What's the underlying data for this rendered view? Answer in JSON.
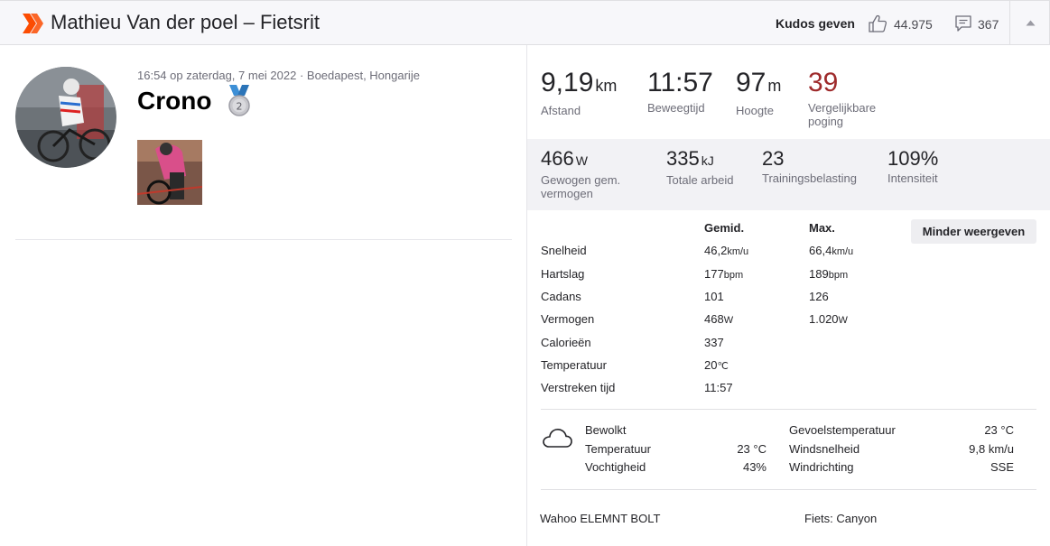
{
  "header": {
    "title": "Mathieu Van der poel – Fietsrit",
    "kudos_label": "Kudos geven",
    "kudos_count": "44.975",
    "comments_count": "367",
    "brand_color": "#fc4c02"
  },
  "activity": {
    "datetime_location": "16:54 op zaterdag, 7 mei 2022 · Boedapest, Hongarije",
    "name": "Crono",
    "medal_rank": "2"
  },
  "primary_stats": [
    {
      "value": "9,19",
      "unit": "km",
      "label": "Afstand"
    },
    {
      "value": "11:57",
      "unit": "",
      "label": "Beweegtijd"
    },
    {
      "value": "97",
      "unit": "m",
      "label": "Hoogte"
    },
    {
      "value": "39",
      "unit": "",
      "label": "Vergelijkbare poging"
    }
  ],
  "secondary_stats": [
    {
      "value": "466",
      "unit": "W",
      "label": "Gewogen gem. vermogen"
    },
    {
      "value": "335",
      "unit": "kJ",
      "label": "Totale arbeid"
    },
    {
      "value": "23",
      "unit": "",
      "label": "Trainingsbelasting"
    },
    {
      "value": "109%",
      "unit": "",
      "label": "Intensiteit"
    }
  ],
  "details": {
    "header_avg": "Gemid.",
    "header_max": "Max.",
    "less_button": "Minder weergeven",
    "rows": [
      {
        "label": "Snelheid",
        "avg": "46,2",
        "avg_unit": "km/u",
        "max": "66,4",
        "max_unit": "km/u"
      },
      {
        "label": "Hartslag",
        "avg": "177",
        "avg_unit": "bpm",
        "max": "189",
        "max_unit": "bpm"
      },
      {
        "label": "Cadans",
        "avg": "101",
        "avg_unit": "",
        "max": "126",
        "max_unit": ""
      },
      {
        "label": "Vermogen",
        "avg": "468",
        "avg_unit": "W",
        "max": "1.020",
        "max_unit": "W"
      },
      {
        "label": "Calorieën",
        "avg": "337",
        "avg_unit": "",
        "max": "",
        "max_unit": ""
      },
      {
        "label": "Temperatuur",
        "avg": "20",
        "avg_unit": "℃",
        "max": "",
        "max_unit": ""
      },
      {
        "label": "Verstreken tijd",
        "avg": "11:57",
        "avg_unit": "",
        "max": "",
        "max_unit": ""
      }
    ]
  },
  "weather": {
    "condition": "Bewolkt",
    "left": [
      {
        "label": "Temperatuur",
        "value": "23 °C"
      },
      {
        "label": "Vochtigheid",
        "value": "43%"
      }
    ],
    "right": [
      {
        "label": "Gevoelstemperatuur",
        "value": "23 °C"
      },
      {
        "label": "Windsnelheid",
        "value": "9,8 km/u"
      },
      {
        "label": "Windrichting",
        "value": "SSE"
      }
    ]
  },
  "gear": {
    "device": "Wahoo ELEMNT BOLT",
    "bike": "Fiets: Canyon"
  }
}
